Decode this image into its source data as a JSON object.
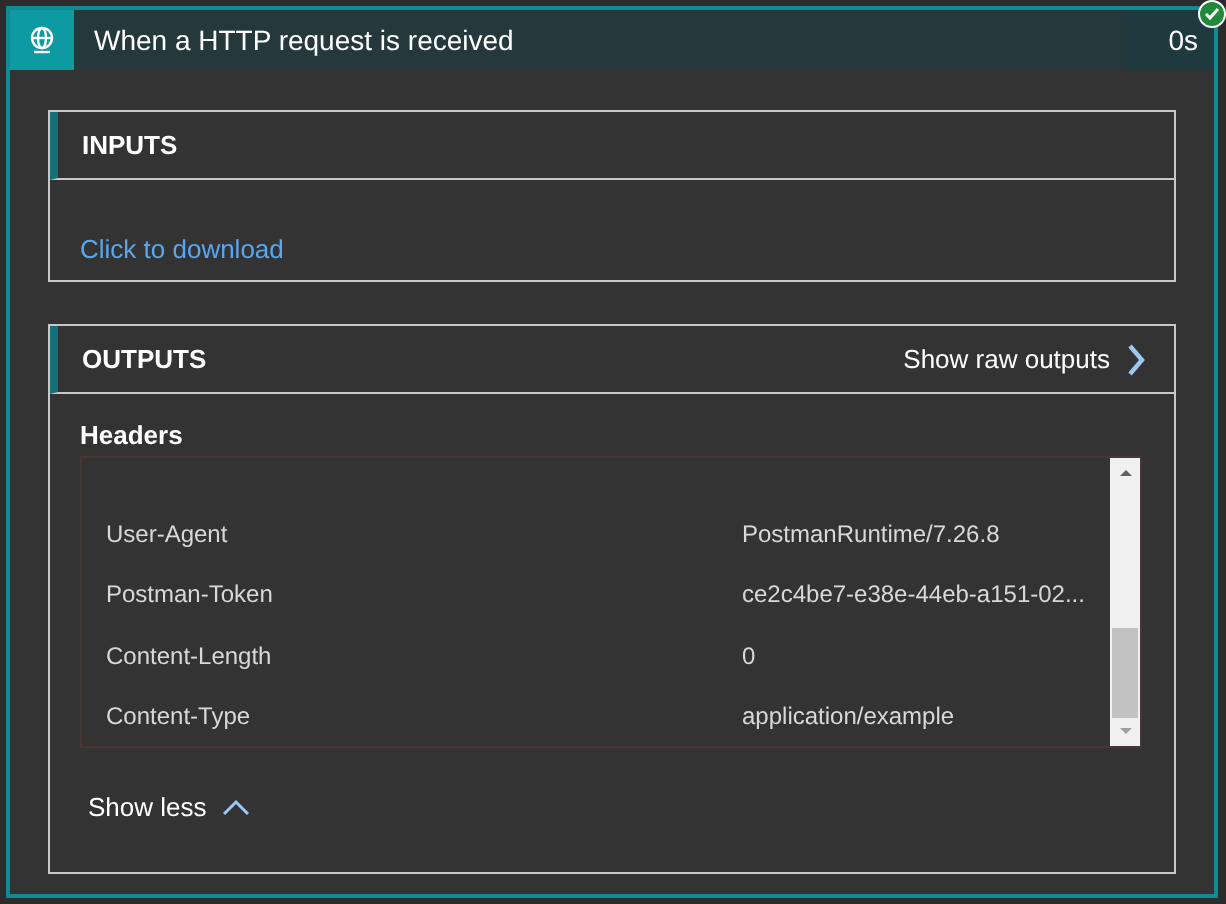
{
  "card": {
    "title": "When a HTTP request is received",
    "duration": "0s",
    "succeeded": true
  },
  "inputs": {
    "heading": "INPUTS",
    "link": "Click to download"
  },
  "outputs": {
    "heading": "OUTPUTS",
    "raw_link": "Show raw outputs",
    "section": "Headers",
    "rows": [
      {
        "key": "User-Agent",
        "value": "PostmanRuntime/7.26.8"
      },
      {
        "key": "Postman-Token",
        "value": "ce2c4be7-e38e-44eb-a151-02..."
      },
      {
        "key": "Content-Length",
        "value": "0"
      },
      {
        "key": "Content-Type",
        "value": "application/example"
      }
    ],
    "toggle": "Show less"
  }
}
